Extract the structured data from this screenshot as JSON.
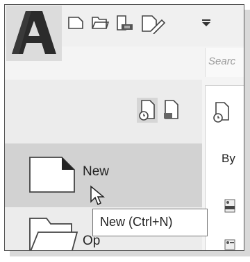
{
  "search": {
    "placeholder_visible": "Searc"
  },
  "menu": {
    "new_label": "New",
    "open_label_partial": "Op"
  },
  "right_panel": {
    "sort_label_partial": "By"
  },
  "tooltip": {
    "text": "New (Ctrl+N)"
  },
  "icons": {
    "app_logo": "autocad-a-logo",
    "qat": [
      "new-icon",
      "open-icon",
      "save-icon",
      "plot-icon",
      "dropdown-icon"
    ],
    "view": [
      "recent-documents-icon",
      "open-documents-icon"
    ]
  },
  "colors": {
    "logo_dark": "#2b2b2b",
    "highlight": "#d2d2d2",
    "panel": "#ececec"
  }
}
